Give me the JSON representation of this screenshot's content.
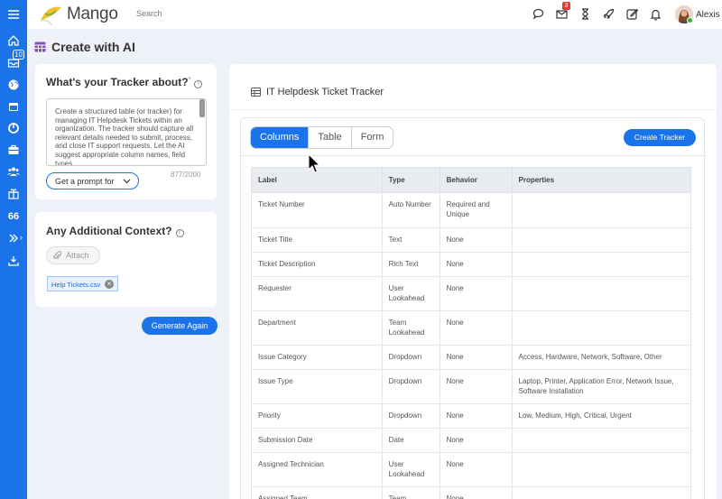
{
  "app": {
    "name": "Mango"
  },
  "topbar": {
    "search_placeholder": "Search",
    "mail_badge": "3",
    "user_name": "Alexis"
  },
  "rail": {
    "inbox_badge": "10",
    "number_label": "66"
  },
  "page": {
    "title": "Create with AI"
  },
  "tracker_card": {
    "heading": "What's your Tracker about?",
    "required_mark": "*",
    "prompt_text": "Create a structured table (or tracker) for managing IT Helpdesk Tickets within an organization. The tracker should capture all relevant details needed to submit, process, and close IT support requests. Let the AI suggest appropriate column names, field types",
    "char_count": "877/2000",
    "prompt_button": "Get a prompt for"
  },
  "context_card": {
    "heading": "Any Additional Context?",
    "attach_label": "Attach",
    "file_chip": "Help Tickets.csv"
  },
  "generate_button": "Generate Again",
  "panel": {
    "title": "IT Helpdesk Ticket Tracker",
    "tabs": [
      "Columns",
      "Table",
      "Form"
    ],
    "active_tab": "Columns",
    "create_button": "Create Tracker"
  },
  "table": {
    "headers": [
      "Label",
      "Type",
      "Behavior",
      "Properties"
    ],
    "rows": [
      {
        "label": "Ticket Number",
        "type": "Auto Number",
        "behavior": "Required and Unique",
        "properties": ""
      },
      {
        "label": "Ticket Title",
        "type": "Text",
        "behavior": "None",
        "properties": ""
      },
      {
        "label": "Ticket Description",
        "type": "Rich Text",
        "behavior": "None",
        "properties": ""
      },
      {
        "label": "Requester",
        "type": "User Lookahead",
        "behavior": "None",
        "properties": ""
      },
      {
        "label": "Department",
        "type": "Team Lookahead",
        "behavior": "None",
        "properties": ""
      },
      {
        "label": "Issue Category",
        "type": "Dropdown",
        "behavior": "None",
        "properties": "Access, Hardware, Network, Software, Other"
      },
      {
        "label": "Issue Type",
        "type": "Dropdown",
        "behavior": "None",
        "properties": "Laptop, Printer, Application Error, Network Issue, Software Installation"
      },
      {
        "label": "Priority",
        "type": "Dropdown",
        "behavior": "None",
        "properties": "Low, Medium, High, Critical, Urgent"
      },
      {
        "label": "Submission Date",
        "type": "Date",
        "behavior": "None",
        "properties": ""
      },
      {
        "label": "Assigned Technician",
        "type": "User Lookahead",
        "behavior": "None",
        "properties": ""
      },
      {
        "label": "Assigned Team",
        "type": "Team",
        "behavior": "None",
        "properties": ""
      }
    ]
  }
}
